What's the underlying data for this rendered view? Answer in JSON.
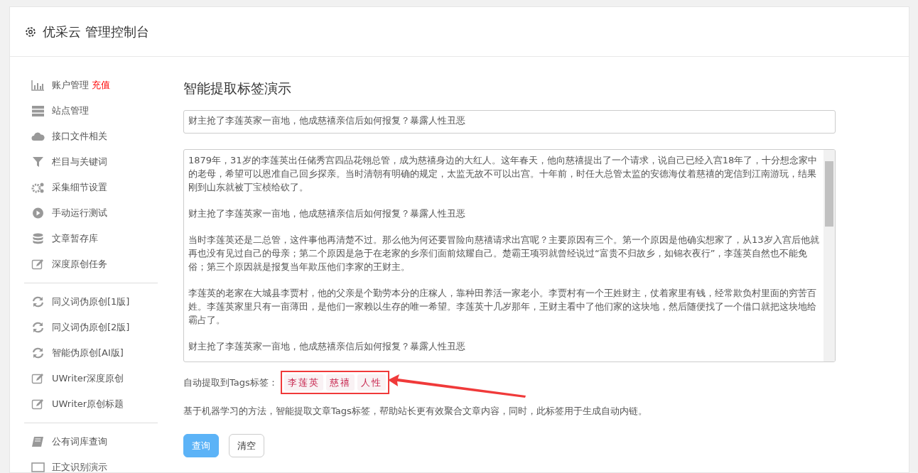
{
  "header": {
    "title": "优采云 管理控制台"
  },
  "sidebar": {
    "groups": [
      {
        "items": [
          {
            "kind": "chart",
            "label": "账户管理",
            "badge": "充值"
          },
          {
            "kind": "server",
            "label": "站点管理"
          },
          {
            "kind": "cloud",
            "label": "接口文件相关"
          },
          {
            "kind": "filter",
            "label": "栏目与关键词"
          },
          {
            "kind": "gears",
            "label": "采集细节设置"
          },
          {
            "kind": "play",
            "label": "手动运行测试"
          },
          {
            "kind": "database",
            "label": "文章暂存库"
          },
          {
            "kind": "edit",
            "label": "深度原创任务"
          }
        ]
      },
      {
        "items": [
          {
            "kind": "refresh",
            "label": "同义词伪原创[1版]"
          },
          {
            "kind": "refresh",
            "label": "同义词伪原创[2版]"
          },
          {
            "kind": "refresh",
            "label": "智能伪原创[AI版]"
          },
          {
            "kind": "edit",
            "label": "UWriter深度原创"
          },
          {
            "kind": "edit",
            "label": "UWriter原创标题"
          }
        ]
      },
      {
        "items": [
          {
            "kind": "book",
            "label": "公有词库查询"
          },
          {
            "kind": "monitor",
            "label": "正文识别演示"
          }
        ]
      }
    ]
  },
  "main": {
    "heading": "智能提取标签演示",
    "title_value": "财主抢了李莲英家一亩地，他成慈禧亲信后如何报复？暴露人性丑恶",
    "article": [
      "1879年，31岁的李莲英出任储秀宫四品花翎总管，成为慈禧身边的大红人。这年春天，他向慈禧提出了一个请求，说自己已经入宫18年了，十分想念家中的老母，希望可以恩准自己回乡探亲。当时清朝有明确的规定，太监无故不可以出宫。十年前，时任大总管太监的安德海仗着慈禧的宠信到江南游玩，结果刚到山东就被丁宝桢给砍了。",
      "财主抢了李莲英家一亩地，他成慈禧亲信后如何报复？暴露人性丑恶",
      "当时李莲英还是二总管，这件事他再清楚不过。那么他为何还要冒险向慈禧请求出宫呢？主要原因有三个。第一个原因是他确实想家了，从13岁入宫后他就再也没有见过自己的母亲；第二个原因是急于在老家的乡亲们面前炫耀自己。楚霸王项羽就曾经说过“富贵不归故乡，如锦衣夜行”，李莲英自然也不能免俗；第三个原因就是报复当年欺压他们李家的王财主。",
      "李莲英的老家在大城县李贾村，他的父亲是个勤劳本分的庄稼人，靠种田养活一家老小。李贾村有一个王姓财主，仗着家里有钱，经常欺负村里面的穷苦百姓。李莲英家里只有一亩薄田，是他们一家赖以生存的唯一希望。李莲英十几岁那年，王财主看中了他们家的这块地，然后随便找了一个借口就把这块地给霸占了。",
      "财主抢了李莲英家一亩地，他成慈禧亲信后如何报复？暴露人性丑恶"
    ],
    "tags_label": "自动提取到Tags标签：",
    "tags": [
      "李莲英",
      "慈禧",
      "人性"
    ],
    "note": "基于机器学习的方法，智能提取文章Tags标签，帮助站长更有效聚合文章内容，同时，此标签用于生成自动内链。",
    "buttons": [
      {
        "kind": "primary",
        "label": "查询"
      },
      {
        "kind": "secondary",
        "label": "清空"
      }
    ]
  }
}
